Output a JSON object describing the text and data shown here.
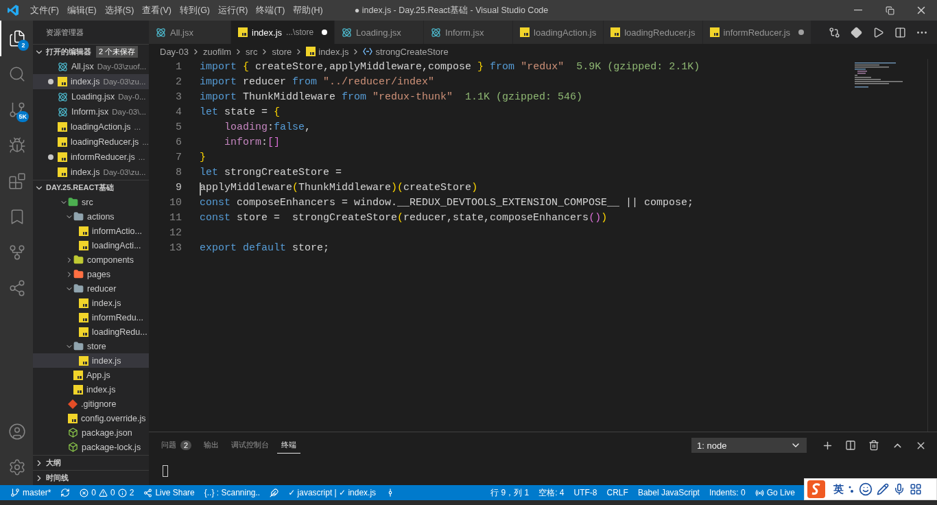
{
  "window": {
    "title": "● index.js - Day.25.React基础 - Visual Studio Code"
  },
  "menu": [
    "文件(F)",
    "编辑(E)",
    "选择(S)",
    "查看(V)",
    "转到(G)",
    "运行(R)",
    "终端(T)",
    "帮助(H)"
  ],
  "activity_bar": {
    "explorer_badge": "2",
    "source_control_badge": "5K"
  },
  "sidebar": {
    "title": "资源管理器",
    "open_editors": {
      "label": "打开的编辑器",
      "expanded": true,
      "badge": "2 个未保存",
      "items": [
        {
          "name": "All.jsx",
          "path": "Day-03\\zuof...",
          "kind": "react",
          "dirty": false,
          "selected": false
        },
        {
          "name": "index.js",
          "path": "Day-03\\zu...",
          "kind": "js",
          "dirty": true,
          "selected": true
        },
        {
          "name": "Loading.jsx",
          "path": "Day-0...",
          "kind": "react",
          "dirty": false,
          "selected": false
        },
        {
          "name": "Inform.jsx",
          "path": "Day-03\\...",
          "kind": "react",
          "dirty": false,
          "selected": false
        },
        {
          "name": "loadingAction.js",
          "path": "...",
          "kind": "js",
          "dirty": false,
          "selected": false
        },
        {
          "name": "loadingReducer.js",
          "path": "...",
          "kind": "js",
          "dirty": false,
          "selected": false
        },
        {
          "name": "informReducer.js",
          "path": "...",
          "kind": "js",
          "dirty": true,
          "selected": false
        },
        {
          "name": "index.js",
          "path": "Day-03\\zu...",
          "kind": "js",
          "dirty": false,
          "selected": false
        }
      ]
    },
    "project": {
      "label": "DAY.25.REACT基础",
      "expanded": true,
      "tree": [
        {
          "name": "src",
          "kind": "src",
          "expanded": true,
          "selected": false,
          "children": [
            {
              "name": "actions",
              "kind": "folder",
              "expanded": true,
              "selected": false,
              "children": [
                {
                  "name": "informActio...",
                  "kind": "js",
                  "selected": false
                },
                {
                  "name": "loadingActi...",
                  "kind": "js",
                  "selected": false
                }
              ]
            },
            {
              "name": "components",
              "kind": "components",
              "expanded": false,
              "selected": false
            },
            {
              "name": "pages",
              "kind": "pages",
              "expanded": false,
              "selected": false
            },
            {
              "name": "reducer",
              "kind": "folder",
              "expanded": true,
              "selected": false,
              "children": [
                {
                  "name": "index.js",
                  "kind": "js",
                  "selected": false
                },
                {
                  "name": "informRedu...",
                  "kind": "js",
                  "selected": false
                },
                {
                  "name": "loadingRedu...",
                  "kind": "js",
                  "selected": false
                }
              ]
            },
            {
              "name": "store",
              "kind": "folder",
              "expanded": true,
              "selected": false,
              "children": [
                {
                  "name": "index.js",
                  "kind": "js",
                  "selected": true
                }
              ]
            },
            {
              "name": "App.js",
              "kind": "js",
              "selected": false
            },
            {
              "name": "index.js",
              "kind": "js",
              "selected": false
            }
          ]
        },
        {
          "name": ".gitignore",
          "kind": "git",
          "selected": false
        },
        {
          "name": "config.override.js",
          "kind": "js",
          "selected": false
        },
        {
          "name": "package.json",
          "kind": "node",
          "selected": false
        },
        {
          "name": "package-lock.js",
          "kind": "node",
          "selected": false
        }
      ]
    },
    "bottom_sections": [
      {
        "label": "大纲",
        "expanded": false
      },
      {
        "label": "时间线",
        "expanded": false
      }
    ]
  },
  "tabs": [
    {
      "label": "All.jsx",
      "kind": "react",
      "selected": false,
      "dirty": false
    },
    {
      "label": "index.js",
      "description": "...\\store",
      "kind": "js",
      "selected": true,
      "dirty": true
    },
    {
      "label": "Loading.jsx",
      "kind": "react",
      "selected": false,
      "dirty": false
    },
    {
      "label": "Inform.jsx",
      "kind": "react",
      "selected": false,
      "dirty": false
    },
    {
      "label": "loadingAction.js",
      "kind": "js",
      "selected": false,
      "dirty": false
    },
    {
      "label": "loadingReducer.js",
      "kind": "js",
      "selected": false,
      "dirty": false
    },
    {
      "label": "informReducer.js",
      "kind": "js",
      "selected": false,
      "dirty": true
    }
  ],
  "breadcrumbs": [
    {
      "label": "Day-03",
      "kind": "text"
    },
    {
      "label": "zuofilm",
      "kind": "text"
    },
    {
      "label": "src",
      "kind": "text"
    },
    {
      "label": "store",
      "kind": "text"
    },
    {
      "label": "index.js",
      "kind": "js"
    },
    {
      "label": "strongCreateStore",
      "kind": "symbol"
    }
  ],
  "editor": {
    "lines": [
      {
        "number": "1",
        "cursor": false,
        "tokens": [
          {
            "text": "import",
            "kind": "keyword"
          },
          {
            "text": " {",
            "kind": "bracket"
          },
          {
            "text": " createStore,applyMiddleware,compose",
            "kind": "plain"
          },
          {
            "text": " }",
            "kind": "bracket"
          },
          {
            "text": " from",
            "kind": "keyword"
          },
          {
            "text": " \"redux\"",
            "kind": "string"
          },
          {
            "text": "  5.9K (gzipped: 2.1K)",
            "kind": "hint"
          }
        ]
      },
      {
        "number": "2",
        "cursor": false,
        "tokens": [
          {
            "text": "import",
            "kind": "keyword"
          },
          {
            "text": " reducer",
            "kind": "plain"
          },
          {
            "text": " from",
            "kind": "keyword"
          },
          {
            "text": " \"../reducer/index\"",
            "kind": "string"
          }
        ]
      },
      {
        "number": "3",
        "cursor": false,
        "tokens": [
          {
            "text": "import",
            "kind": "keyword"
          },
          {
            "text": " ThunkMiddleware",
            "kind": "plain"
          },
          {
            "text": " from",
            "kind": "keyword"
          },
          {
            "text": " \"redux-thunk\"",
            "kind": "string"
          },
          {
            "text": "  1.1K (gzipped: 546)",
            "kind": "hint"
          }
        ]
      },
      {
        "number": "4",
        "cursor": false,
        "tokens": [
          {
            "text": "let",
            "kind": "keyword"
          },
          {
            "text": " state =",
            "kind": "plain"
          },
          {
            "text": " {",
            "kind": "bracket"
          }
        ]
      },
      {
        "number": "5",
        "cursor": false,
        "tokens": [
          {
            "text": "    loading",
            "kind": "property"
          },
          {
            "text": ":",
            "kind": "plain"
          },
          {
            "text": "false",
            "kind": "keyword"
          },
          {
            "text": ",",
            "kind": "plain"
          }
        ]
      },
      {
        "number": "6",
        "cursor": false,
        "tokens": [
          {
            "text": "    inform",
            "kind": "property"
          },
          {
            "text": ":",
            "kind": "plain"
          },
          {
            "text": "[]",
            "kind": "bracket2"
          }
        ]
      },
      {
        "number": "7",
        "cursor": false,
        "tokens": [
          {
            "text": "}",
            "kind": "bracket"
          }
        ]
      },
      {
        "number": "8",
        "cursor": false,
        "tokens": [
          {
            "text": "let",
            "kind": "keyword"
          },
          {
            "text": " strongCreateStore =",
            "kind": "plain"
          }
        ]
      },
      {
        "number": "9",
        "cursor": true,
        "tokens": [
          {
            "text": "applyMiddleware",
            "kind": "plain"
          },
          {
            "text": "(",
            "kind": "bracket"
          },
          {
            "text": "ThunkMiddleware",
            "kind": "plain"
          },
          {
            "text": ")(",
            "kind": "bracket"
          },
          {
            "text": "createStore",
            "kind": "plain"
          },
          {
            "text": ")",
            "kind": "bracket"
          }
        ]
      },
      {
        "number": "10",
        "cursor": false,
        "tokens": [
          {
            "text": "const",
            "kind": "keyword"
          },
          {
            "text": " composeEnhancers = window.__REDUX_DEVTOOLS_EXTENSION_COMPOSE__ || compose;",
            "kind": "plain"
          }
        ]
      },
      {
        "number": "11",
        "cursor": false,
        "tokens": [
          {
            "text": "const",
            "kind": "keyword"
          },
          {
            "text": " store =  strongCreateStore",
            "kind": "plain"
          },
          {
            "text": "(",
            "kind": "bracket"
          },
          {
            "text": "reducer,state,composeEnhancers",
            "kind": "plain"
          },
          {
            "text": "()",
            "kind": "bracket2"
          },
          {
            "text": ")",
            "kind": "bracket"
          }
        ]
      },
      {
        "number": "12",
        "cursor": false
      },
      {
        "number": "13",
        "cursor": false,
        "tokens": [
          {
            "text": "export",
            "kind": "keyword"
          },
          {
            "text": " default",
            "kind": "keyword"
          },
          {
            "text": " store;",
            "kind": "plain"
          }
        ]
      }
    ]
  },
  "panel": {
    "tabs": [
      {
        "label": "问题",
        "badge": "2",
        "selected": false
      },
      {
        "label": "输出",
        "selected": false
      },
      {
        "label": "调试控制台",
        "selected": false
      },
      {
        "label": "终端",
        "selected": true
      }
    ],
    "terminal_select": "1: node"
  },
  "status_bar": {
    "branch": "master*",
    "errors": "0",
    "warnings": "0",
    "infos": "2",
    "live_share": "Live Share",
    "scanning": "{..} : Scanning..",
    "language_check": "✓ javascript | ✓ index.js",
    "right": [
      "行 9，列 1",
      "空格: 4",
      "UTF-8",
      "CRLF",
      "Babel JavaScript",
      "Indents: 0"
    ],
    "go_live": "Go Live"
  },
  "ime_toolbar": {
    "mode": "英"
  }
}
